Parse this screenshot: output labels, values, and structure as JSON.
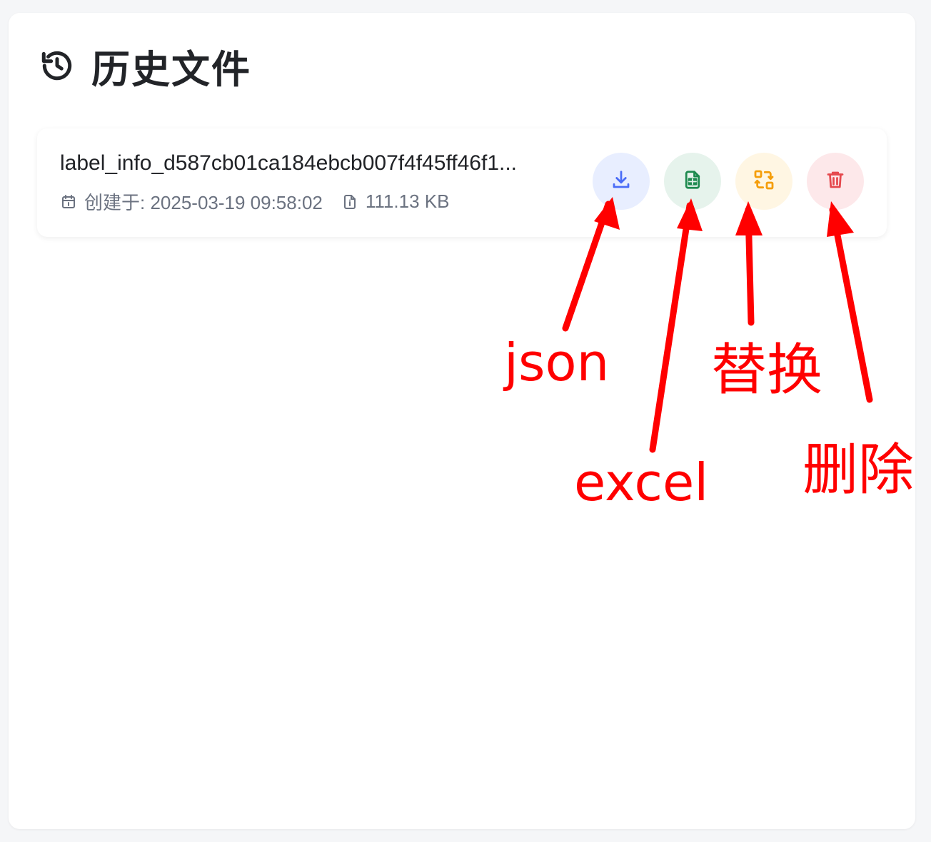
{
  "header": {
    "title": "历史文件",
    "icon": "history-icon"
  },
  "file": {
    "name": "label_info_d587cb01ca184ebcb007f4f45ff46f1...",
    "created_label": "创建于: 2025-03-19 09:58:02",
    "size": "111.13 KB"
  },
  "actions": [
    {
      "name": "json-download",
      "icon": "download-icon",
      "color": "#4a6cf7"
    },
    {
      "name": "excel-export",
      "icon": "spreadsheet-icon",
      "color": "#1e8a4f"
    },
    {
      "name": "replace",
      "icon": "swap-icon",
      "color": "#f59e0b"
    },
    {
      "name": "delete",
      "icon": "trash-icon",
      "color": "#e5484d"
    }
  ],
  "annotations": {
    "json": "json",
    "excel": "excel",
    "replace": "替换",
    "delete": "删除",
    "color": "#ff0000"
  }
}
